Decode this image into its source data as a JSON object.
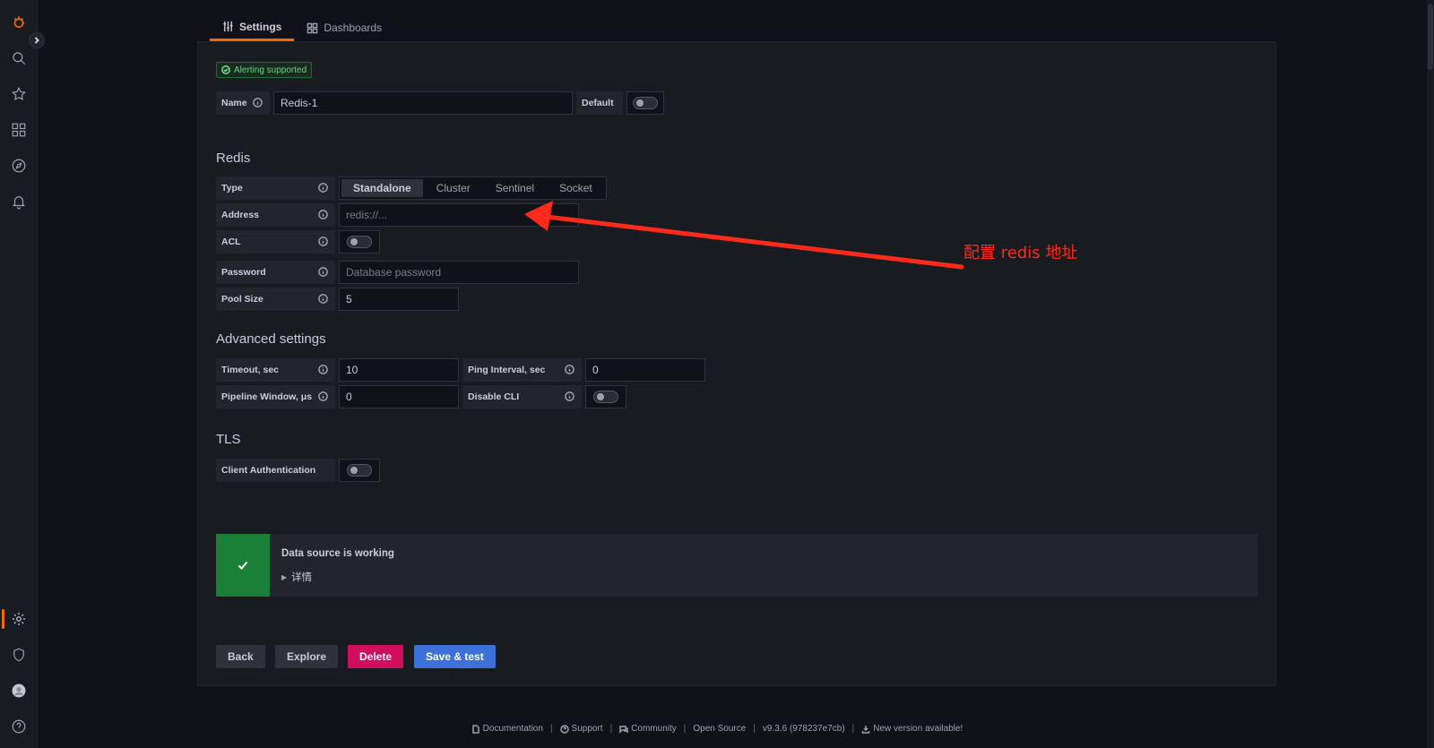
{
  "tabs": [
    {
      "label": "Settings",
      "icon": "sliders-icon",
      "active": true
    },
    {
      "label": "Dashboards",
      "icon": "apps-icon",
      "active": false
    }
  ],
  "badge": {
    "label": "Alerting supported"
  },
  "name_row": {
    "label": "Name",
    "value": "Redis-1",
    "default_label": "Default"
  },
  "redis": {
    "heading": "Redis",
    "type_label": "Type",
    "type_options": [
      "Standalone",
      "Cluster",
      "Sentinel",
      "Socket"
    ],
    "type_selected": "Standalone",
    "address_label": "Address",
    "address_placeholder": "redis://...",
    "acl_label": "ACL",
    "password_label": "Password",
    "password_placeholder": "Database password",
    "pool_label": "Pool Size",
    "pool_value": "5"
  },
  "advanced": {
    "heading": "Advanced settings",
    "timeout_label": "Timeout, sec",
    "timeout_value": "10",
    "ping_label": "Ping Interval, sec",
    "ping_value": "0",
    "pipeline_label": "Pipeline Window, μs",
    "pipeline_value": "0",
    "disable_cli_label": "Disable CLI"
  },
  "tls": {
    "heading": "TLS",
    "client_auth_label": "Client Authentication"
  },
  "alert": {
    "title": "Data source is working",
    "details": "详情",
    "color": "#1a7f37"
  },
  "buttons": {
    "back": "Back",
    "explore": "Explore",
    "delete": "Delete",
    "save": "Save & test"
  },
  "annotation": {
    "text": "配置 redis 地址",
    "color": "#ff2a1a"
  },
  "footer": {
    "documentation": "Documentation",
    "support": "Support",
    "community": "Community",
    "open_source": "Open Source",
    "version": "v9.3.6 (978237e7cb)",
    "new_version": "New version available!"
  },
  "colors": {
    "accent": "#f46800",
    "primary": "#3d71d9",
    "danger": "#d10e5c",
    "success": "#1a7f37"
  }
}
